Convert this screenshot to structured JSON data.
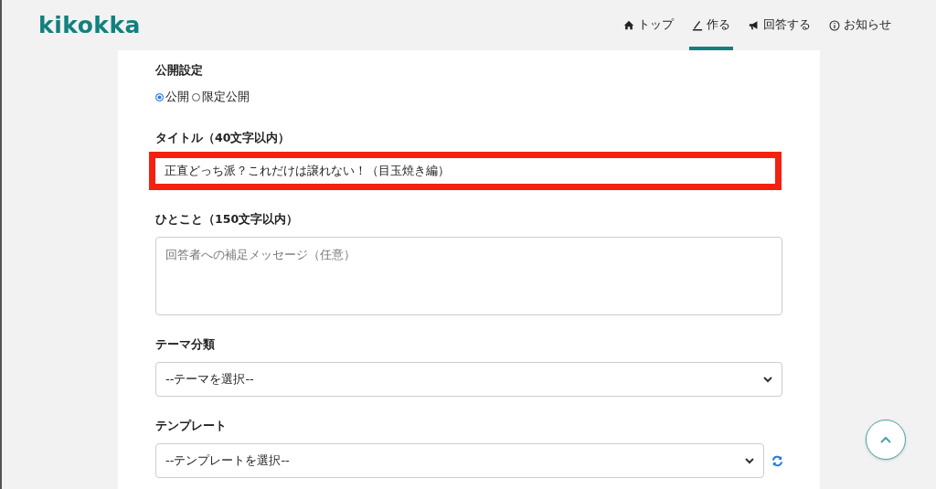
{
  "header": {
    "logo": "kikokka",
    "nav": [
      {
        "label": "トップ",
        "selected": false
      },
      {
        "label": "作る",
        "selected": true
      },
      {
        "label": "回答する",
        "selected": false
      },
      {
        "label": "お知らせ",
        "selected": false
      }
    ]
  },
  "form": {
    "visibility": {
      "label": "公開設定",
      "options": [
        {
          "label": "公開",
          "selected": true
        },
        {
          "label": "限定公開",
          "selected": false
        }
      ]
    },
    "fields": [
      {
        "kind": "input",
        "label": "タイトル（40文字以内）",
        "value": "正直どっち派？これだけは譲れない！（目玉焼き編）",
        "highlighted": true
      },
      {
        "kind": "textarea",
        "label": "ひとこと（150文字以内）",
        "placeholder": "回答者への補足メッセージ（任意）",
        "highlighted": false
      },
      {
        "kind": "select",
        "label": "テーマ分類",
        "value": "--テーマを選択--",
        "highlighted": false
      },
      {
        "kind": "select-refresh",
        "label": "テンプレート",
        "value": "--テンプレートを選択--",
        "highlighted": false
      }
    ]
  }
}
